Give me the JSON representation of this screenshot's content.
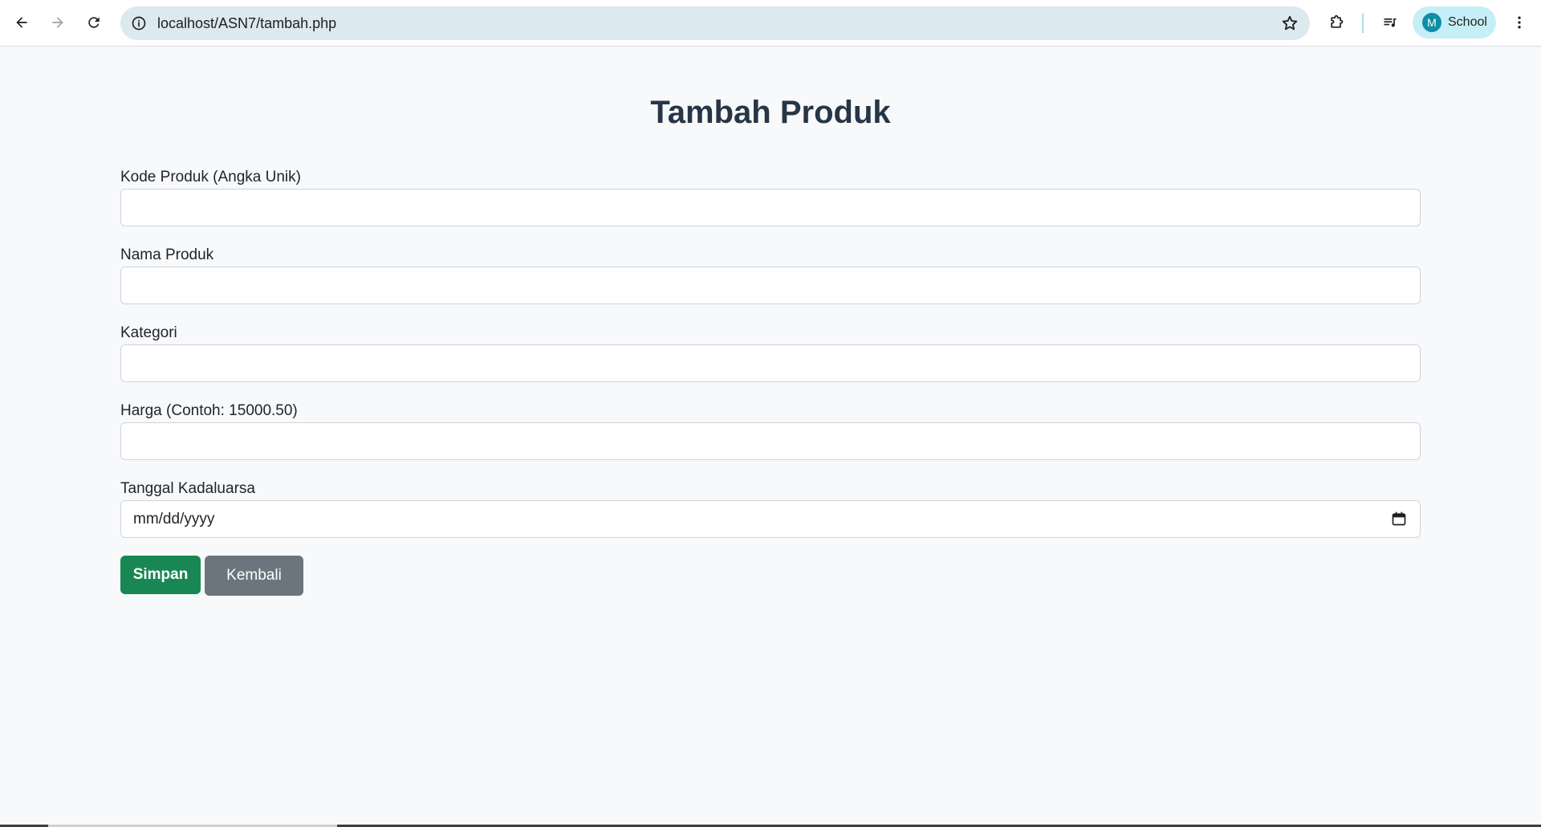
{
  "browser": {
    "url": "localhost/ASN7/tambah.php",
    "profile_initial": "M",
    "profile_name": "School"
  },
  "page": {
    "title": "Tambah Produk",
    "fields": [
      {
        "label": "Kode Produk (Angka Unik)",
        "value": ""
      },
      {
        "label": "Nama Produk",
        "value": ""
      },
      {
        "label": "Kategori",
        "value": ""
      },
      {
        "label": "Harga (Contoh: 15000.50)",
        "value": ""
      },
      {
        "label": "Tanggal Kadaluarsa",
        "value": "mm/dd/yyyy"
      }
    ],
    "save_label": "Simpan",
    "back_label": "Kembali"
  },
  "colors": {
    "save": "#198754",
    "back": "#6c757d",
    "title": "#263646"
  },
  "icons": {
    "back": "arrow-left-icon",
    "forward": "arrow-right-icon",
    "reload": "reload-icon",
    "info": "info-icon",
    "bookmark": "star-icon",
    "extensions": "puzzle-icon",
    "media": "media-controls-icon",
    "menu": "kebab-menu-icon",
    "calendar": "calendar-icon"
  }
}
